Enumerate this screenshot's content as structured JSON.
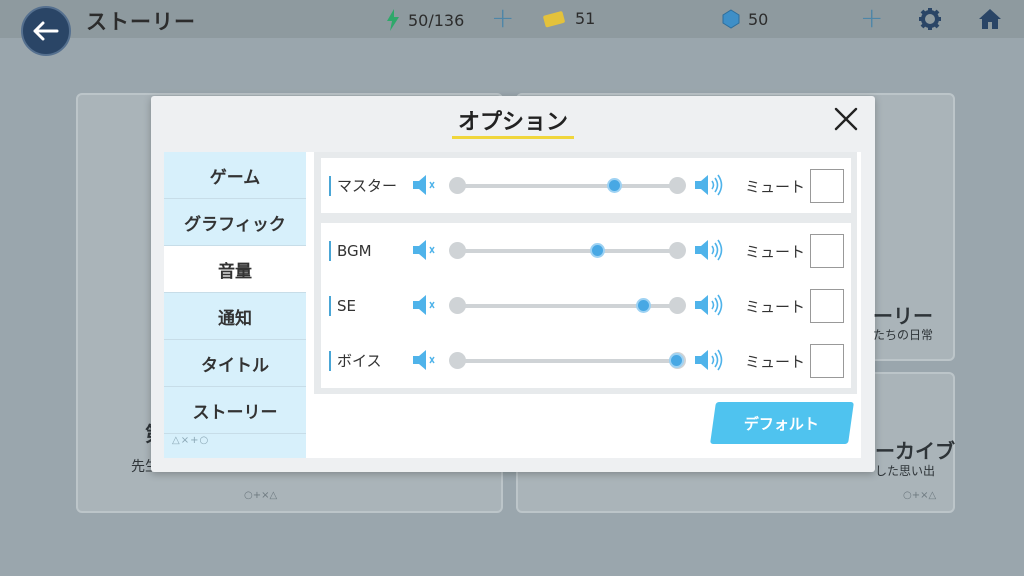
{
  "header": {
    "title": "ストーリー",
    "stamina": "50/136",
    "tickets": "51",
    "crystals": "50"
  },
  "background": {
    "left_card_big": "第",
    "left_card_sub": "先生",
    "right_card_title_1": "ーリー",
    "right_card_sub_1": "たちの日常",
    "right_card_title_2": "ーカイブ",
    "right_card_sub_2": "した思い出",
    "deco_symbols": "○+×△"
  },
  "modal": {
    "title": "オプション",
    "tabs": [
      {
        "label": "ゲーム"
      },
      {
        "label": "グラフィック"
      },
      {
        "label": "音量"
      },
      {
        "label": "通知"
      },
      {
        "label": "タイトル"
      },
      {
        "label": "ストーリー"
      }
    ],
    "active_tab": 2,
    "sidebar_symbols": "△×+○",
    "mute_label": "ミュート",
    "default_button": "デフォルト",
    "volume_rows": [
      {
        "label": "マスター",
        "value": 0.72,
        "muted": false
      },
      {
        "label": "BGM",
        "value": 0.64,
        "muted": false
      },
      {
        "label": "SE",
        "value": 0.85,
        "muted": false
      },
      {
        "label": "ボイス",
        "value": 1.0,
        "muted": false
      }
    ]
  },
  "colors": {
    "accent_blue": "#48a8e4",
    "title_underline": "#f0d63c",
    "sidebar_bg": "#d7f0fb",
    "button_bg": "#4fc3ef"
  }
}
